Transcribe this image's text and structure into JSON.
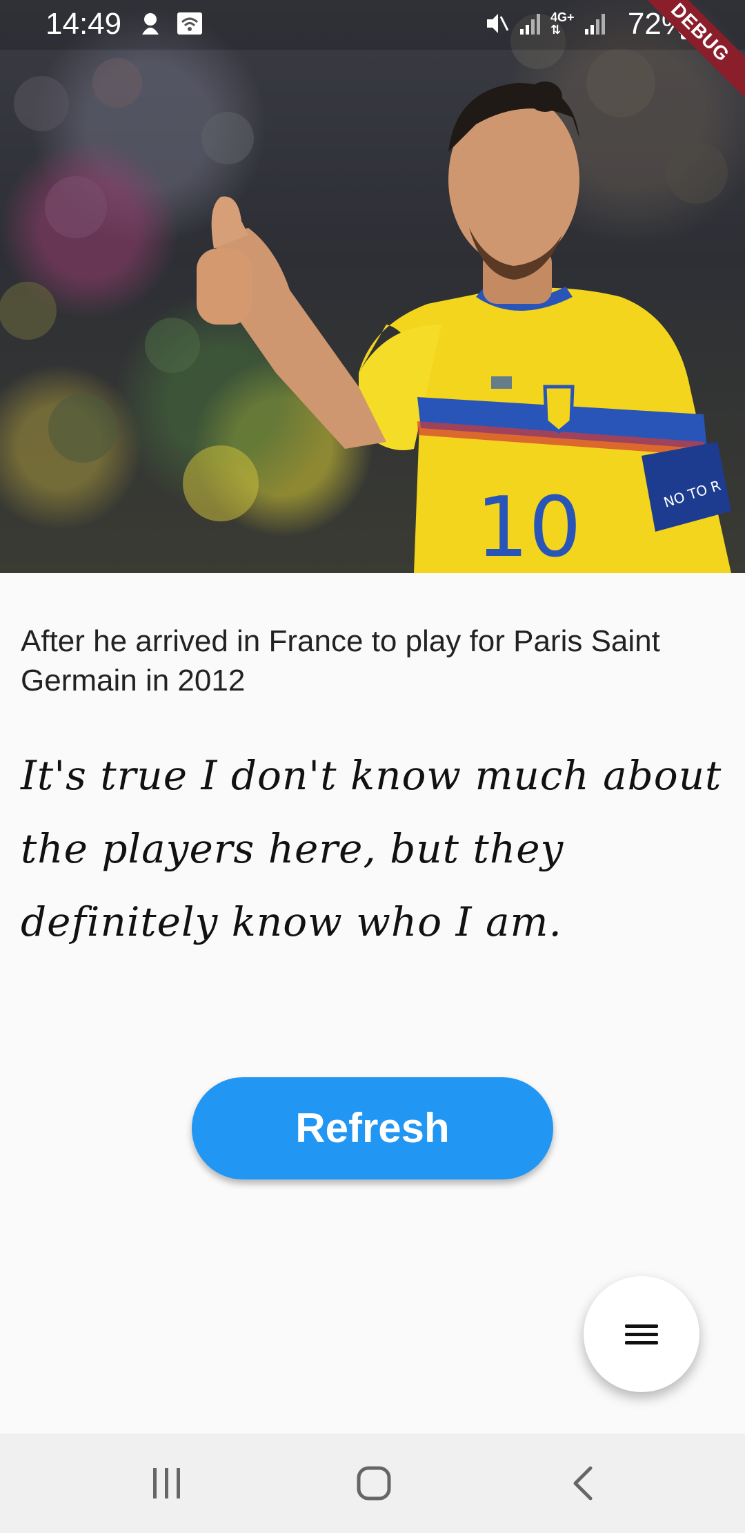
{
  "status_bar": {
    "time": "14:49",
    "battery": "72%",
    "debug_label": "DEBUG",
    "icons": [
      "notification-icon",
      "wifi-icon",
      "mute-icon",
      "signal-icon",
      "4g-icon",
      "signal-icon",
      "battery-icon"
    ]
  },
  "hero": {
    "image_subject": "football player in yellow jersey number 10 giving a thumbs up",
    "jersey_number": "10",
    "armband_text": "NO TO R"
  },
  "content": {
    "caption": "After he arrived in France to play for Paris Saint Germain in 2012",
    "quote": "It's true I don't know much about the players here, but they definitely know who I am."
  },
  "actions": {
    "refresh_label": "Refresh",
    "fab_icon": "menu-icon"
  },
  "nav_bar": {
    "icons": [
      "recents-icon",
      "home-icon",
      "back-icon"
    ]
  },
  "colors": {
    "accent": "#2196f3",
    "debug_ribbon": "#8b1e2b",
    "background": "#fafafa"
  }
}
